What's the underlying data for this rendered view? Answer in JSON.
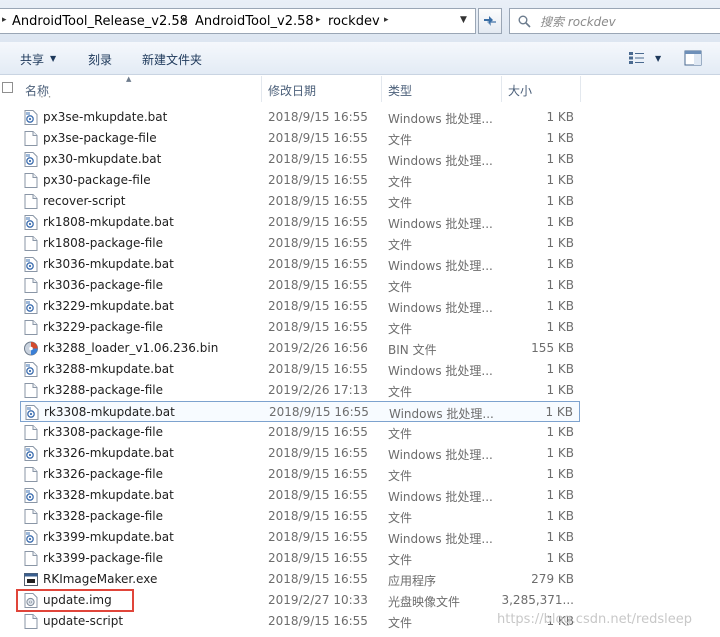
{
  "address_bar": {
    "crumbs": [
      "AndroidTool_Release_v2.58",
      "AndroidTool_v2.58",
      "rockdev"
    ],
    "separator": "▸"
  },
  "search": {
    "placeholder": "搜索 rockdev"
  },
  "toolbar": {
    "share_label": "共享",
    "burn_label": "刻录",
    "new_folder_label": "新建文件夹"
  },
  "columns": {
    "name": "名称",
    "date": "修改日期",
    "type": "类型",
    "size": "大小"
  },
  "files": [
    {
      "name": "px3se-mkupdate.bat",
      "date": "2018/9/15 16:55",
      "type": "Windows 批处理...",
      "size": "1 KB",
      "icon": "batch-file-icon"
    },
    {
      "name": "px3se-package-file",
      "date": "2018/9/15 16:55",
      "type": "文件",
      "size": "1 KB",
      "icon": "file-icon"
    },
    {
      "name": "px30-mkupdate.bat",
      "date": "2018/9/15 16:55",
      "type": "Windows 批处理...",
      "size": "1 KB",
      "icon": "batch-file-icon"
    },
    {
      "name": "px30-package-file",
      "date": "2018/9/15 16:55",
      "type": "文件",
      "size": "1 KB",
      "icon": "file-icon"
    },
    {
      "name": "recover-script",
      "date": "2018/9/15 16:55",
      "type": "文件",
      "size": "1 KB",
      "icon": "file-icon"
    },
    {
      "name": "rk1808-mkupdate.bat",
      "date": "2018/9/15 16:55",
      "type": "Windows 批处理...",
      "size": "1 KB",
      "icon": "batch-file-icon"
    },
    {
      "name": "rk1808-package-file",
      "date": "2018/9/15 16:55",
      "type": "文件",
      "size": "1 KB",
      "icon": "file-icon"
    },
    {
      "name": "rk3036-mkupdate.bat",
      "date": "2018/9/15 16:55",
      "type": "Windows 批处理...",
      "size": "1 KB",
      "icon": "batch-file-icon"
    },
    {
      "name": "rk3036-package-file",
      "date": "2018/9/15 16:55",
      "type": "文件",
      "size": "1 KB",
      "icon": "file-icon"
    },
    {
      "name": "rk3229-mkupdate.bat",
      "date": "2018/9/15 16:55",
      "type": "Windows 批处理...",
      "size": "1 KB",
      "icon": "batch-file-icon"
    },
    {
      "name": "rk3229-package-file",
      "date": "2018/9/15 16:55",
      "type": "文件",
      "size": "1 KB",
      "icon": "file-icon"
    },
    {
      "name": "rk3288_loader_v1.06.236.bin",
      "date": "2019/2/26 16:56",
      "type": "BIN 文件",
      "size": "155 KB",
      "icon": "bin-file-icon"
    },
    {
      "name": "rk3288-mkupdate.bat",
      "date": "2018/9/15 16:55",
      "type": "Windows 批处理...",
      "size": "1 KB",
      "icon": "batch-file-icon"
    },
    {
      "name": "rk3288-package-file",
      "date": "2019/2/26 17:13",
      "type": "文件",
      "size": "1 KB",
      "icon": "file-icon"
    },
    {
      "name": "rk3308-mkupdate.bat",
      "date": "2018/9/15 16:55",
      "type": "Windows 批处理...",
      "size": "1 KB",
      "icon": "batch-file-icon",
      "selected": true
    },
    {
      "name": "rk3308-package-file",
      "date": "2018/9/15 16:55",
      "type": "文件",
      "size": "1 KB",
      "icon": "file-icon"
    },
    {
      "name": "rk3326-mkupdate.bat",
      "date": "2018/9/15 16:55",
      "type": "Windows 批处理...",
      "size": "1 KB",
      "icon": "batch-file-icon"
    },
    {
      "name": "rk3326-package-file",
      "date": "2018/9/15 16:55",
      "type": "文件",
      "size": "1 KB",
      "icon": "file-icon"
    },
    {
      "name": "rk3328-mkupdate.bat",
      "date": "2018/9/15 16:55",
      "type": "Windows 批处理...",
      "size": "1 KB",
      "icon": "batch-file-icon"
    },
    {
      "name": "rk3328-package-file",
      "date": "2018/9/15 16:55",
      "type": "文件",
      "size": "1 KB",
      "icon": "file-icon"
    },
    {
      "name": "rk3399-mkupdate.bat",
      "date": "2018/9/15 16:55",
      "type": "Windows 批处理...",
      "size": "1 KB",
      "icon": "batch-file-icon"
    },
    {
      "name": "rk3399-package-file",
      "date": "2018/9/15 16:55",
      "type": "文件",
      "size": "1 KB",
      "icon": "file-icon"
    },
    {
      "name": "RKImageMaker.exe",
      "date": "2018/9/15 16:55",
      "type": "应用程序",
      "size": "279 KB",
      "icon": "exe-file-icon"
    },
    {
      "name": "update.img",
      "date": "2019/2/27 10:33",
      "type": "光盘映像文件",
      "size": "3,285,371...",
      "icon": "disc-image-icon"
    },
    {
      "name": "update-script",
      "date": "2018/9/15 16:55",
      "type": "文件",
      "size": "1 KB",
      "icon": "file-icon"
    }
  ],
  "watermark": "https://blog.csdn.net/redsleep",
  "colors": {
    "highlight": "#e0453a",
    "selection_border": "#7da2ce",
    "header_text": "#4c607a"
  }
}
